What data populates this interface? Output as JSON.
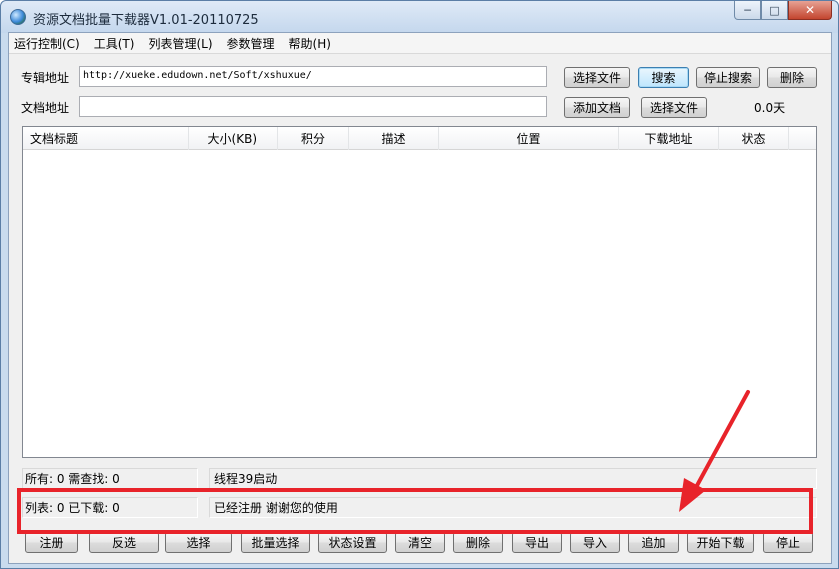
{
  "window": {
    "title": "资源文档批量下载器V1.01-20110725",
    "controls": [
      "─",
      "□",
      "✕"
    ]
  },
  "menu": [
    "运行控制(C)",
    "工具(T)",
    "列表管理(L)",
    "参数管理",
    "帮助(H)"
  ],
  "form": {
    "album_label": "专辑地址",
    "album_url": "http://xueke.edudown.net/Soft/xshuxue/",
    "doc_label": "文档地址",
    "doc_url": "",
    "buttons": {
      "select_file_1": "选择文件",
      "search": "搜索",
      "stop_search": "停止搜索",
      "delete": "删除",
      "add_doc": "添加文档",
      "select_file_2": "选择文件"
    },
    "days_value": "0.0天"
  },
  "list": {
    "columns": [
      "文档标题",
      "大小(KB)",
      "积分",
      "描述",
      "位置",
      "下载地址",
      "状态"
    ],
    "rows": []
  },
  "status": {
    "counts_1": "所有: 0 需查找: 0",
    "message_1": "线程39启动",
    "counts_2": "列表: 0 已下载: 0",
    "message_2": "已经注册 谢谢您的使用"
  },
  "bottom_buttons": {
    "register": "注册",
    "invert": "反选",
    "select": "选择",
    "batch_select": "批量选择",
    "status_settings": "状态设置",
    "clear": "清空",
    "delete": "删除",
    "export": "导出",
    "import": "导入",
    "append": "追加",
    "start_download": "开始下载",
    "stop": "停止"
  },
  "colors": {
    "highlight": "#e8232a",
    "window_frame": "#c9dbee"
  },
  "icons": {
    "app": "globe-app-icon",
    "annotation": "red-arrow-icon"
  }
}
